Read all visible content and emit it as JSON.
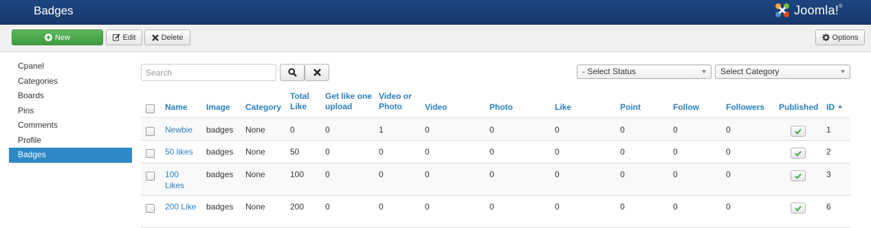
{
  "header": {
    "title": "Badges",
    "logo_text": "Joomla!",
    "logo_mark": "®"
  },
  "toolbar": {
    "new_label": "New",
    "edit_label": "Edit",
    "delete_label": "Delete",
    "options_label": "Options"
  },
  "sidebar": {
    "items": [
      {
        "label": "Cpanel"
      },
      {
        "label": "Categories"
      },
      {
        "label": "Boards"
      },
      {
        "label": "Pins"
      },
      {
        "label": "Comments"
      },
      {
        "label": "Profile"
      },
      {
        "label": "Badges",
        "active": true
      }
    ]
  },
  "filters": {
    "search_placeholder": "Search",
    "status_selected": "- Select Status",
    "category_selected": "Select Category"
  },
  "table": {
    "columns": [
      {
        "key": "name",
        "label": "Name"
      },
      {
        "key": "image",
        "label": "Image"
      },
      {
        "key": "category",
        "label": "Category"
      },
      {
        "key": "total_like",
        "label": "Total Like"
      },
      {
        "key": "get_like_one_upload",
        "label": "Get like one upload"
      },
      {
        "key": "video_or_photo",
        "label": "Video or Photo"
      },
      {
        "key": "video",
        "label": "Video"
      },
      {
        "key": "photo",
        "label": "Photo"
      },
      {
        "key": "like",
        "label": "Like"
      },
      {
        "key": "point",
        "label": "Point"
      },
      {
        "key": "follow",
        "label": "Follow"
      },
      {
        "key": "followers",
        "label": "Followers"
      },
      {
        "key": "published",
        "label": "Published"
      },
      {
        "key": "id",
        "label": "ID"
      }
    ],
    "rows": [
      {
        "name": "Newbie",
        "image": "badges",
        "category": "None",
        "total_like": "0",
        "get_like_one_upload": "0",
        "video_or_photo": "1",
        "video": "0",
        "photo": "0",
        "like": "0",
        "point": "0",
        "follow": "0",
        "followers": "0",
        "published": true,
        "id": "1"
      },
      {
        "name": "50 likes",
        "image": "badges",
        "category": "None",
        "total_like": "50",
        "get_like_one_upload": "0",
        "video_or_photo": "0",
        "video": "0",
        "photo": "0",
        "like": "0",
        "point": "0",
        "follow": "0",
        "followers": "0",
        "published": true,
        "id": "2"
      },
      {
        "name": "100 Likes",
        "image": "badges",
        "category": "None",
        "total_like": "100",
        "get_like_one_upload": "0",
        "video_or_photo": "0",
        "video": "0",
        "photo": "0",
        "like": "0",
        "point": "0",
        "follow": "0",
        "followers": "0",
        "published": true,
        "id": "3"
      },
      {
        "name": "200 Like",
        "image": "badges",
        "category": "None",
        "total_like": "200",
        "get_like_one_upload": "0",
        "video_or_photo": "0",
        "video": "0",
        "photo": "0",
        "like": "0",
        "point": "0",
        "follow": "0",
        "followers": "0",
        "published": true,
        "id": "6"
      }
    ]
  },
  "colors": {
    "header_bg": "#1c4580",
    "accent": "#2a7fc1",
    "active_sidebar": "#2d8ac7",
    "new_button": "#4cae4c"
  },
  "icons": {
    "new": "plus-circle-icon",
    "edit": "pencil-square-icon",
    "delete": "x-icon",
    "options": "gear-icon",
    "search": "search-icon",
    "clear": "x-icon",
    "published": "check-icon",
    "sort": "sort-ascending-icon"
  }
}
